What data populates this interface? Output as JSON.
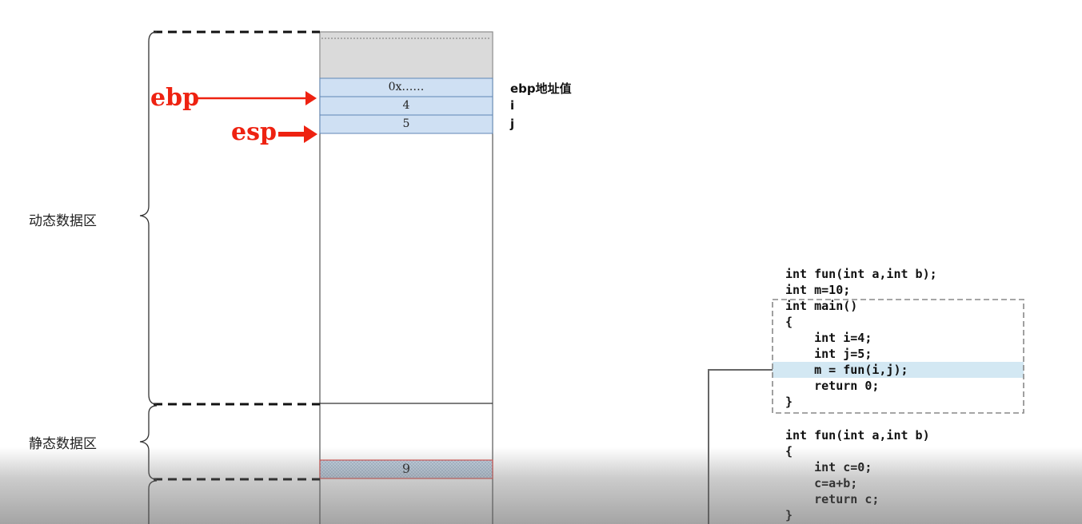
{
  "regions": {
    "dynamic": "动态数据区",
    "static": "静态数据区"
  },
  "pointers": {
    "ebp": "ebp",
    "esp": "esp"
  },
  "stack_cells": [
    {
      "value": "0x……",
      "label": "ebp地址值"
    },
    {
      "value": "4",
      "label": "i"
    },
    {
      "value": "5",
      "label": "j"
    }
  ],
  "static_cell": {
    "value": "9"
  },
  "code": {
    "lines": [
      "int fun(int a,int b);",
      "int m=10;",
      "int main()",
      "{",
      "    int i=4;",
      "    int j=5;",
      "    m = fun(i,j);",
      "    return 0;",
      "}",
      "",
      "int fun(int a,int b)",
      "{",
      "    int c=0;",
      "    c=a+b;",
      "    return c;",
      "}"
    ],
    "highlighted_line_index": 6
  },
  "colors": {
    "pointer": "#ee2211",
    "stack_cell_fill": "#cfe0f3",
    "stack_cell_border": "#5f86b5",
    "top_block_fill": "#dadada",
    "highlight_line": "#d3e8f3",
    "static_cell_border": "#d9534f"
  }
}
